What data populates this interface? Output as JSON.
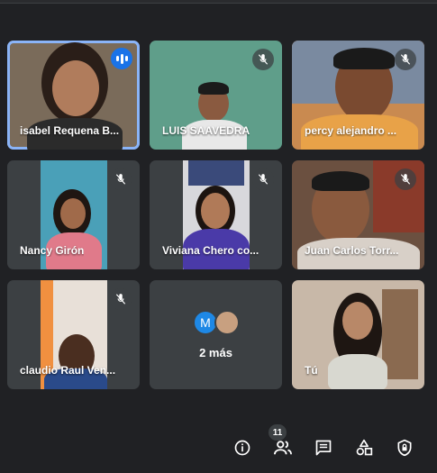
{
  "participants": [
    {
      "name": "isabel Requena B...",
      "speaking": true
    },
    {
      "name": "LUIS SAAVEDRA",
      "muted": true
    },
    {
      "name": "percy alejandro ...",
      "muted": true
    },
    {
      "name": "Nancy Girón",
      "muted": true
    },
    {
      "name": "Viviana Chero co...",
      "muted": true
    },
    {
      "name": "Juan Carlos Torr...",
      "muted": true
    },
    {
      "name": "claudio Raul Ven...",
      "muted": true
    },
    {
      "name": "Tú"
    }
  ],
  "more": {
    "label": "2 más",
    "avatar_letter": "M",
    "avatar_color": "#1e88e5"
  },
  "toolbar": {
    "people_count": "11"
  },
  "colors": {
    "background": "#202124",
    "tile": "#3c4043",
    "active_outline": "#8ab4f8",
    "speaking": "#1a73e8"
  }
}
